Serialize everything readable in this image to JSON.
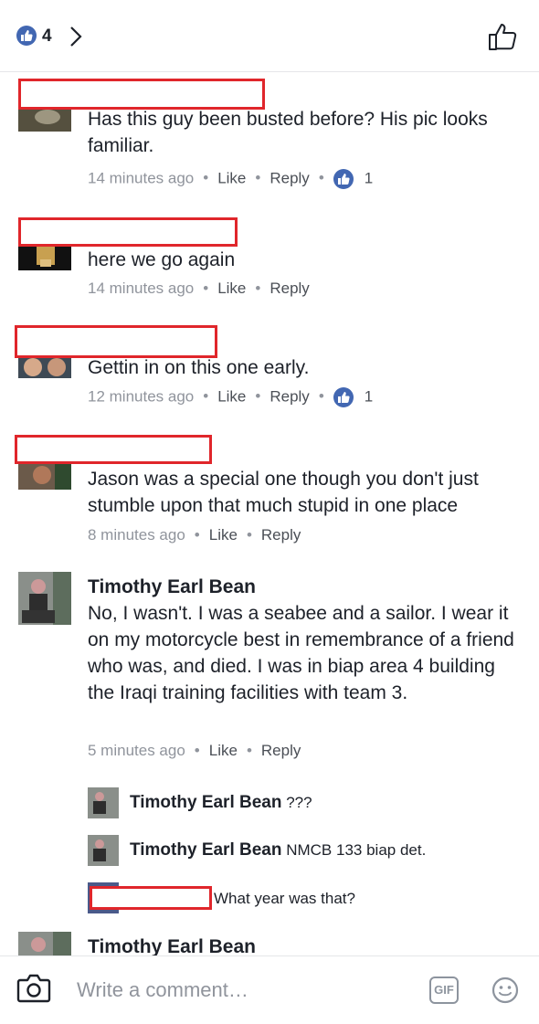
{
  "header": {
    "like_count": "4"
  },
  "comments": [
    {
      "text": "Has this guy been busted before? His pic looks familiar.",
      "time": "14 minutes ago",
      "like": "Like",
      "reply": "Reply",
      "reactions": "1"
    },
    {
      "text": "here we go again",
      "time": "14 minutes ago",
      "like": "Like",
      "reply": "Reply"
    },
    {
      "text": "Gettin in on this one early.",
      "time": "12 minutes ago",
      "like": "Like",
      "reply": "Reply",
      "reactions": "1"
    },
    {
      "text": "Jason was a special one though you don't just stumble upon that much stupid in one place",
      "time": "8 minutes ago",
      "like": "Like",
      "reply": "Reply"
    },
    {
      "name": "Timothy Earl Bean",
      "text": "No, I wasn't. I was a seabee and a sailor. I wear it on my motorcycle best in remembrance of a friend who was, and died. I was in biap area 4 building the Iraqi training facilities with team 3.",
      "time": "5 minutes ago",
      "like": "Like",
      "reply": "Reply"
    }
  ],
  "replies": [
    {
      "name": "Timothy Earl Bean",
      "text": "???"
    },
    {
      "name": "Timothy Earl Bean",
      "text": "NMCB 133 biap det."
    },
    {
      "text": "What year was that?"
    }
  ],
  "next_comment": {
    "name": "Timothy Earl Bean"
  },
  "composer": {
    "placeholder": "Write a comment…",
    "gif_label": "GIF"
  },
  "colors": {
    "accent": "#4267b2",
    "redaction": "#e0262b",
    "meta": "#90949c"
  }
}
